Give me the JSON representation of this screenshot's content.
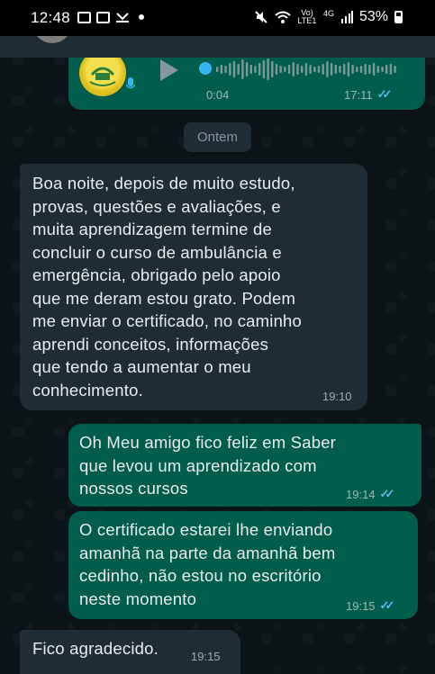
{
  "status_bar": {
    "time": "12:48",
    "network_label": "Vo) LTE1",
    "network_type": "4G",
    "battery": "53%"
  },
  "voice_message": {
    "duration": "0:04",
    "time": "17:11",
    "progress": 0.0
  },
  "date_divider": "Ontem",
  "messages": [
    {
      "direction": "incoming",
      "lines": [
        "Boa noite, depois de muito estudo,",
        "provas, questões e avaliações, e",
        "muita aprendizagem termine de",
        "concluir o curso de ambulância e",
        "emergência, obrigado pelo apoio",
        "que me deram estou grato. Podem",
        "me enviar o certificado, no caminho",
        "aprendi conceitos, informações",
        "que tendo a aumentar o meu",
        "conhecimento."
      ],
      "time": "19:10"
    },
    {
      "direction": "outgoing",
      "lines": [
        "Oh Meu amigo fico feliz em Saber",
        "que levou um aprendizado com",
        "nossos cursos"
      ],
      "time": "19:14"
    },
    {
      "direction": "outgoing",
      "lines": [
        "O certificado estarei lhe enviando",
        "amanhã na parte da amanhã bem",
        "cedinho, não estou no escritório",
        "neste momento"
      ],
      "time": "19:15"
    },
    {
      "direction": "incoming",
      "lines": [
        "Fico agradecido."
      ],
      "time": "19:15"
    }
  ],
  "colors": {
    "incoming_bubble": "#1f2c34",
    "outgoing_bubble": "#005c4b",
    "read_ticks": "#53bdeb",
    "background": "#0b141a"
  }
}
